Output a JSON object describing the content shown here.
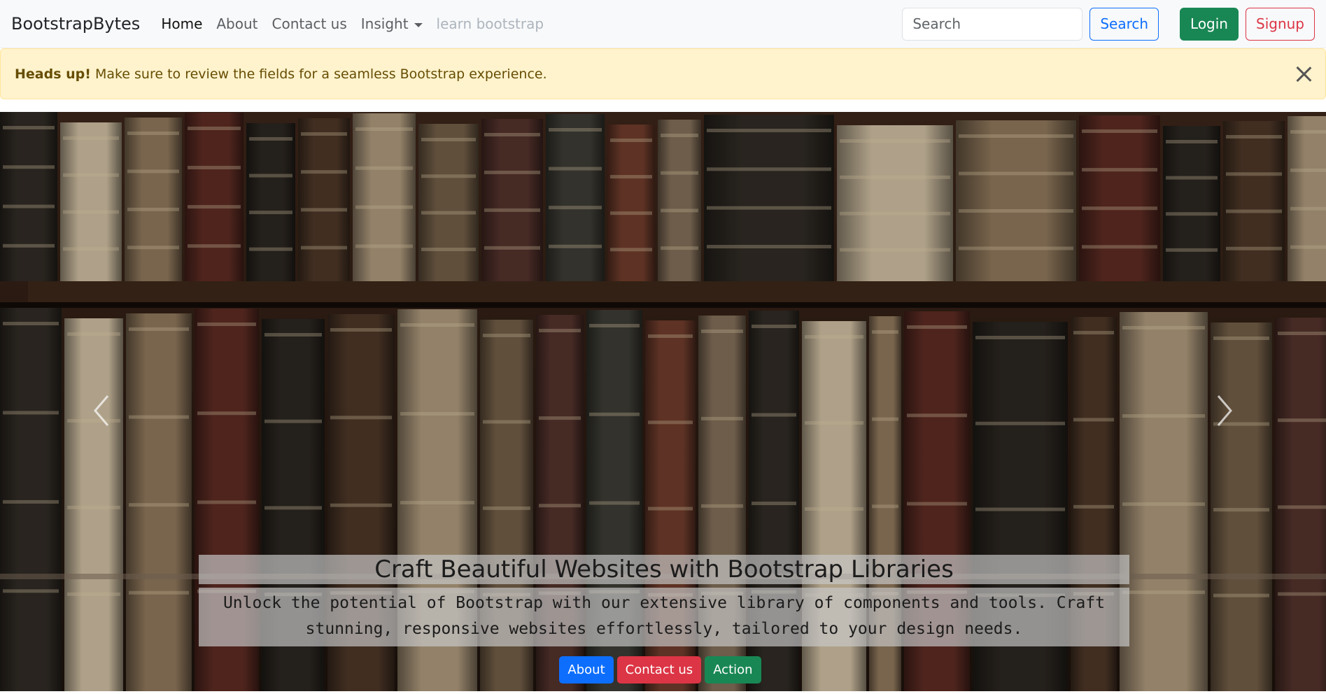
{
  "navbar": {
    "brand": "BootstrapBytes",
    "links": [
      {
        "label": "Home"
      },
      {
        "label": "About"
      },
      {
        "label": "Contact us"
      },
      {
        "label": "Insight"
      },
      {
        "label": "learn bootstrap"
      }
    ],
    "search_placeholder": "Search",
    "search_button": "Search",
    "login_button": "Login",
    "signup_button": "Signup"
  },
  "alert": {
    "strong": "Heads up!",
    "message": "Make sure to review the fields for a seamless Bootstrap experience."
  },
  "carousel": {
    "caption_title": "Craft Beautiful Websites with Bootstrap Libraries",
    "caption_text": "Unlock the potential of Bootstrap with our extensive library of components and tools. Craft stunning, responsive websites effortlessly, tailored to your design needs.",
    "buttons": [
      {
        "label": "About"
      },
      {
        "label": "Contact us"
      },
      {
        "label": "Action"
      }
    ]
  },
  "colors": {
    "primary": "#0d6efd",
    "danger": "#dc3545",
    "success": "#198754",
    "alert_bg": "#fff3cd",
    "alert_text": "#664d03"
  }
}
